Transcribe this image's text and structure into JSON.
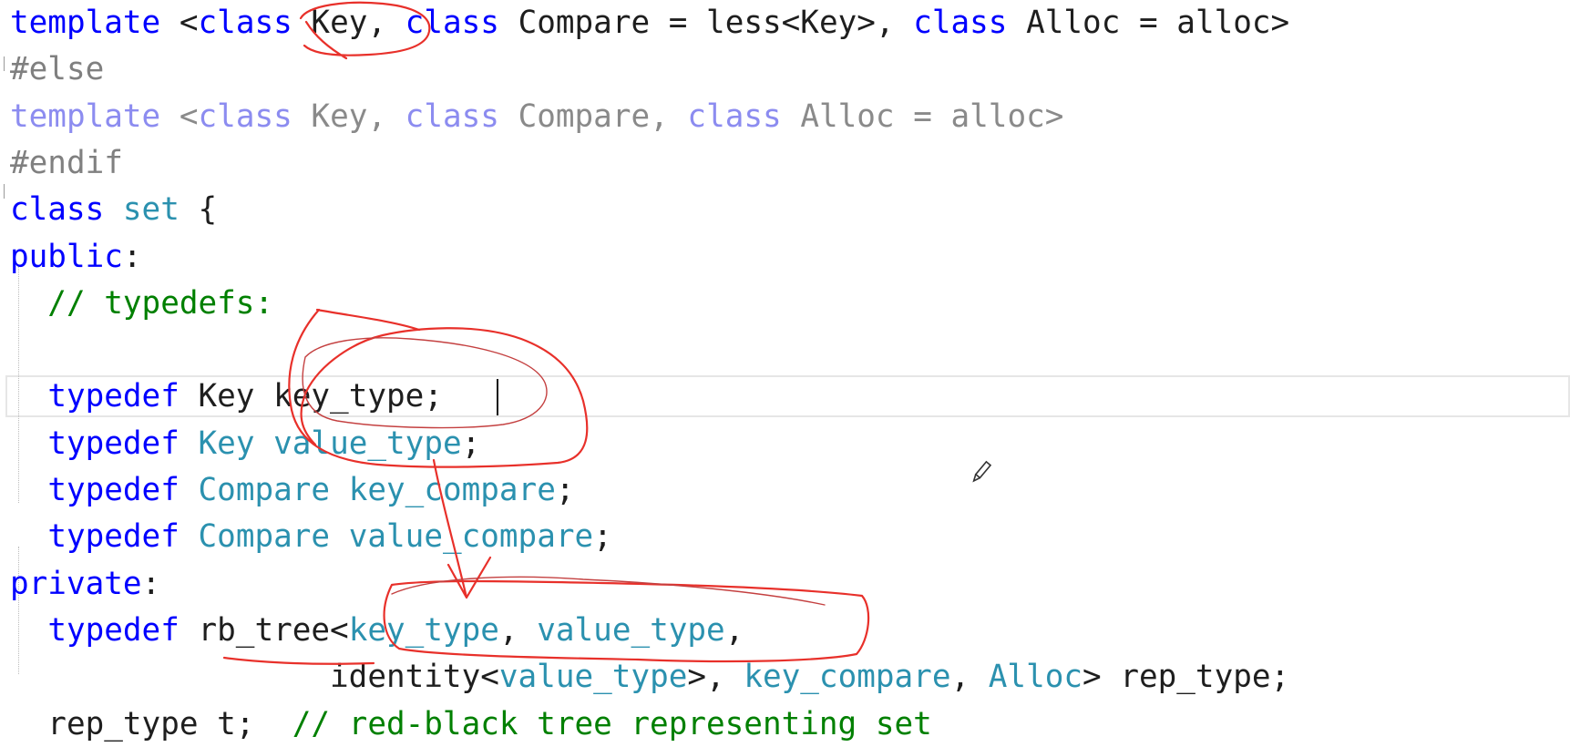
{
  "editor": {
    "lines": [
      [
        {
          "t": "template",
          "c": "kw"
        },
        {
          "t": " <",
          "c": "tx"
        },
        {
          "t": "class",
          "c": "kw"
        },
        {
          "t": " Key, ",
          "c": "tx"
        },
        {
          "t": "class",
          "c": "kw"
        },
        {
          "t": " Compare = less<Key>, ",
          "c": "tx"
        },
        {
          "t": "class",
          "c": "kw"
        },
        {
          "t": " Alloc = alloc>",
          "c": "tx"
        }
      ],
      [
        {
          "t": "#else",
          "c": "pp"
        }
      ],
      [
        {
          "t": "template",
          "c": "kwdim"
        },
        {
          "t": " <",
          "c": "dim"
        },
        {
          "t": "class",
          "c": "kwdim"
        },
        {
          "t": " Key, ",
          "c": "dim"
        },
        {
          "t": "class",
          "c": "kwdim"
        },
        {
          "t": " Compare, ",
          "c": "dim"
        },
        {
          "t": "class",
          "c": "kwdim"
        },
        {
          "t": " Alloc = alloc>",
          "c": "dim"
        }
      ],
      [
        {
          "t": "#endif",
          "c": "pp"
        }
      ],
      [
        {
          "t": "class",
          "c": "kw"
        },
        {
          "t": " ",
          "c": "tx"
        },
        {
          "t": "set",
          "c": "ty"
        },
        {
          "t": " {",
          "c": "tx"
        }
      ],
      [
        {
          "t": "public",
          "c": "kw"
        },
        {
          "t": ":",
          "c": "tx"
        }
      ],
      [
        {
          "t": "  // typedefs:",
          "c": "cm"
        }
      ],
      [
        {
          "t": "",
          "c": "tx"
        }
      ],
      [
        {
          "t": "  ",
          "c": "tx"
        },
        {
          "t": "typedef",
          "c": "kw"
        },
        {
          "t": " Key key_type;",
          "c": "tx"
        }
      ],
      [
        {
          "t": "  ",
          "c": "tx"
        },
        {
          "t": "typedef",
          "c": "kw"
        },
        {
          "t": " ",
          "c": "tx"
        },
        {
          "t": "Key",
          "c": "ty"
        },
        {
          "t": " ",
          "c": "tx"
        },
        {
          "t": "value_type",
          "c": "ty"
        },
        {
          "t": ";",
          "c": "tx"
        }
      ],
      [
        {
          "t": "  ",
          "c": "tx"
        },
        {
          "t": "typedef",
          "c": "kw"
        },
        {
          "t": " ",
          "c": "tx"
        },
        {
          "t": "Compare",
          "c": "ty"
        },
        {
          "t": " ",
          "c": "tx"
        },
        {
          "t": "key_compare",
          "c": "ty"
        },
        {
          "t": ";",
          "c": "tx"
        }
      ],
      [
        {
          "t": "  ",
          "c": "tx"
        },
        {
          "t": "typedef",
          "c": "kw"
        },
        {
          "t": " ",
          "c": "tx"
        },
        {
          "t": "Compare",
          "c": "ty"
        },
        {
          "t": " ",
          "c": "tx"
        },
        {
          "t": "value_compare",
          "c": "ty"
        },
        {
          "t": ";",
          "c": "tx"
        }
      ],
      [
        {
          "t": "private",
          "c": "kw"
        },
        {
          "t": ":",
          "c": "tx"
        }
      ],
      [
        {
          "t": "  ",
          "c": "tx"
        },
        {
          "t": "typedef",
          "c": "kw"
        },
        {
          "t": " rb_tree<",
          "c": "tx"
        },
        {
          "t": "key_type",
          "c": "ty"
        },
        {
          "t": ", ",
          "c": "tx"
        },
        {
          "t": "value_type",
          "c": "ty"
        },
        {
          "t": ",",
          "c": "tx"
        }
      ],
      [
        {
          "t": "                 identity<",
          "c": "tx"
        },
        {
          "t": "value_type",
          "c": "ty"
        },
        {
          "t": ">, ",
          "c": "tx"
        },
        {
          "t": "key_compare",
          "c": "ty"
        },
        {
          "t": ", ",
          "c": "tx"
        },
        {
          "t": "Alloc",
          "c": "ty"
        },
        {
          "t": "> rep_type;",
          "c": "tx"
        }
      ],
      [
        {
          "t": "  rep_type t;  ",
          "c": "tx"
        },
        {
          "t": "// red-black tree representing set",
          "c": "cm"
        }
      ]
    ]
  },
  "colors": {
    "keyword": "#0000ff",
    "type": "#2b91af",
    "comment": "#008000",
    "preprocessor": "#808080",
    "annotation": "#e8302a"
  },
  "icons": {
    "cursor": "pencil-cursor-icon"
  }
}
